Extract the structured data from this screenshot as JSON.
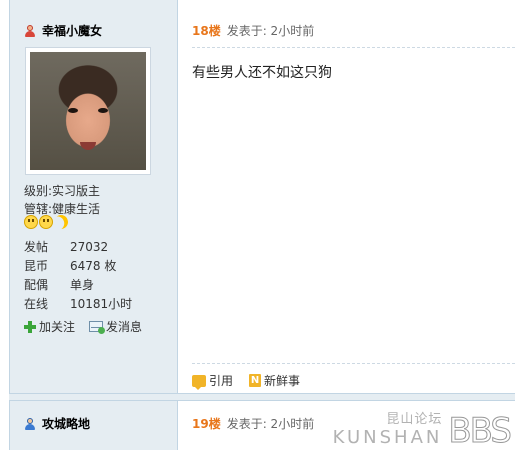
{
  "post1": {
    "username": "幸福小魔女",
    "level_label": "级别:",
    "level_value": "实习版主",
    "manage_label": "管辖:",
    "manage_value": "健康生活",
    "stats": [
      {
        "label": "发帖",
        "value": "27032"
      },
      {
        "label": "昆币",
        "value": "6478 枚"
      },
      {
        "label": "配偶",
        "value": "单身"
      },
      {
        "label": "在线",
        "value": "10181小时"
      }
    ],
    "follow_label": "加关注",
    "message_label": "发消息",
    "floor": "18楼",
    "posted_at": "发表于: 2小时前",
    "content": "有些男人还不如这只狗",
    "quote_label": "引用",
    "new_label": "新鲜事"
  },
  "post2": {
    "username": "攻城略地",
    "floor": "19楼",
    "posted_at": "发表于: 2小时前"
  },
  "watermark": {
    "cn": "昆山论坛",
    "en": "KUNSHAN",
    "bbs": "BBS"
  },
  "icons": {
    "user_female": "female-user-icon",
    "user_male": "male-user-icon",
    "follow": "plus-icon",
    "message": "mail-icon",
    "quote": "quote-icon",
    "new": "new-icon"
  },
  "colors": {
    "sidebar_bg": "#e5edf2",
    "floor": "#e8761b",
    "divider": "#c2d5e3"
  }
}
